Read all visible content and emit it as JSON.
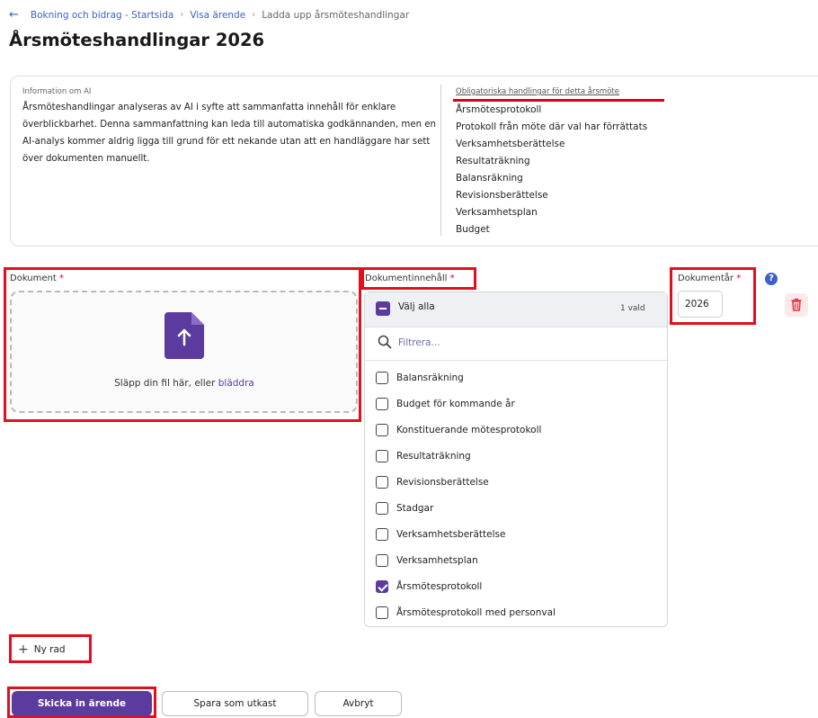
{
  "breadcrumb": {
    "items": [
      "Bokning och bidrag - Startsida",
      "Visa ärende"
    ],
    "current": "Ladda upp årsmöteshandlingar"
  },
  "page_title": "Årsmöteshandlingar 2026",
  "info": {
    "label": "Information om AI",
    "text": "Årsmöteshandlingar analyseras av AI i syfte att sammanfatta innehåll för enklare överblickbarhet. Denna sammanfattning kan leda till automatiska godkännanden, men en AI-analys kommer aldrig ligga till grund för ett nekande utan att en handläggare har sett över dokumenten manuellt.",
    "required_title": "Obligatoriska handlingar för detta årsmöte",
    "required_docs": [
      "Årsmötesprotokoll",
      "Protokoll från möte där val har förrättats",
      "Verksamhetsberättelse",
      "Resultaträkning",
      "Balansräkning",
      "Revisionsberättelse",
      "Verksamhetsplan",
      "Budget"
    ]
  },
  "document": {
    "label": "Dokument",
    "required_mark": "*",
    "drop_text": "Släpp din fil här, eller ",
    "browse_link": "bläddra"
  },
  "content": {
    "label": "Dokumentinnehåll",
    "required_mark": "*",
    "select_all": "Välj alla",
    "selected_count": "1 vald",
    "filter_placeholder": "Filtrera...",
    "options": [
      {
        "label": "Balansräkning",
        "checked": false
      },
      {
        "label": "Budget för kommande år",
        "checked": false
      },
      {
        "label": "Konstituerande mötesprotokoll",
        "checked": false
      },
      {
        "label": "Resultaträkning",
        "checked": false
      },
      {
        "label": "Revisionsberättelse",
        "checked": false
      },
      {
        "label": "Stadgar",
        "checked": false
      },
      {
        "label": "Verksamhetsberättelse",
        "checked": false
      },
      {
        "label": "Verksamhetsplan",
        "checked": false
      },
      {
        "label": "Årsmötesprotokoll",
        "checked": true
      },
      {
        "label": "Årsmötesprotokoll med personval",
        "checked": false
      }
    ]
  },
  "year": {
    "label": "Dokumentår",
    "required_mark": "*",
    "value": "2026",
    "help_icon": "?"
  },
  "actions": {
    "new_row": "Ny rad",
    "submit": "Skicka in ärende",
    "save_draft": "Spara som utkast",
    "cancel": "Avbryt"
  },
  "colors": {
    "accent": "#5b3b9e",
    "link": "#3d5fc8",
    "highlight": "#e0101e",
    "required": "#d9001b"
  }
}
